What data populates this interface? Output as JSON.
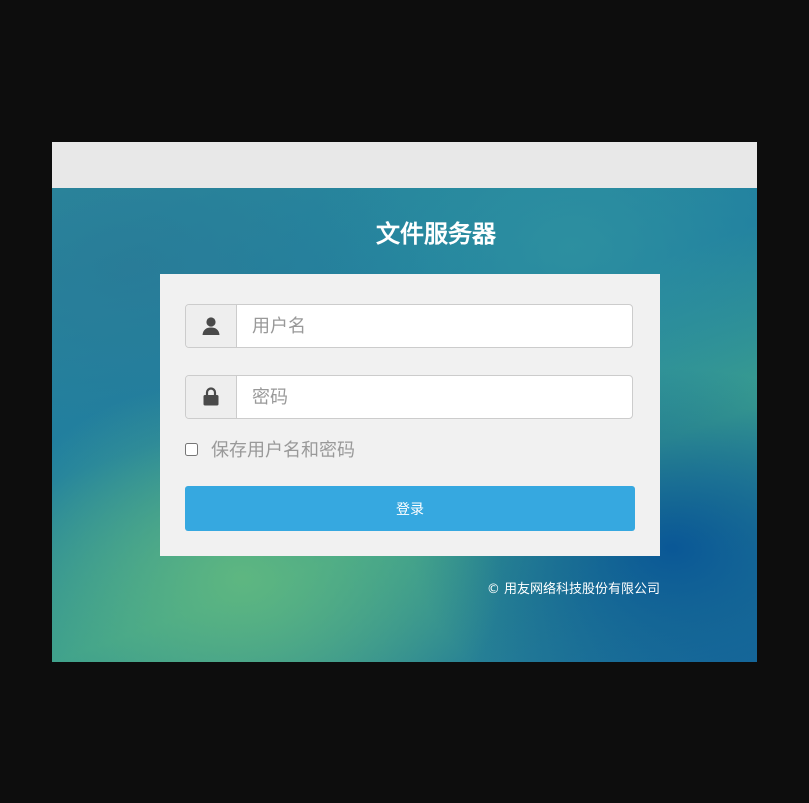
{
  "app": {
    "title": "文件服务器"
  },
  "login": {
    "username_placeholder": "用户名",
    "password_placeholder": "密码",
    "remember_label": "保存用户名和密码",
    "remember_checked": false,
    "submit_label": "登录"
  },
  "footer": {
    "copyright": "© 用友网络科技股份有限公司"
  },
  "icons": {
    "username": "user-icon",
    "password": "lock-icon"
  },
  "colors": {
    "button": "#36a8e0",
    "card": "#f1f1f1",
    "topbar": "#e8e8e8"
  }
}
